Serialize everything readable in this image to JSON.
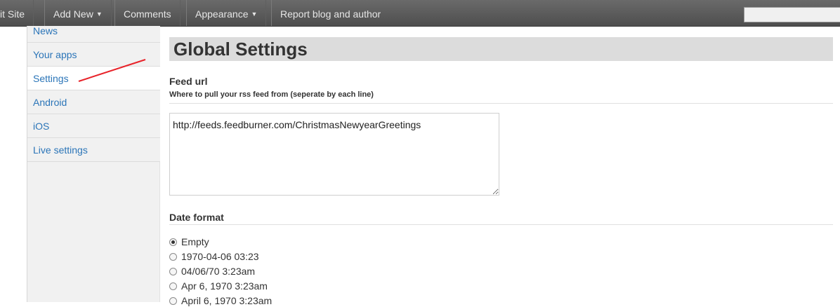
{
  "topbar": {
    "items": [
      {
        "label": "it Site"
      },
      {
        "label": "Add New",
        "caret": "▼"
      },
      {
        "label": "Comments"
      },
      {
        "label": "Appearance",
        "caret": "▼"
      },
      {
        "label": "Report blog and author"
      }
    ],
    "search": {
      "value": ""
    }
  },
  "sidebar": {
    "items": [
      {
        "label": "News"
      },
      {
        "label": "Your apps"
      },
      {
        "label": "Settings"
      },
      {
        "label": "Android"
      },
      {
        "label": "iOS"
      },
      {
        "label": "Live settings"
      }
    ],
    "active": "Settings"
  },
  "main": {
    "title": "Global Settings",
    "feed": {
      "heading": "Feed url",
      "subheading": "Where to pull your rss feed from (seperate by each line)",
      "value": "http://feeds.feedburner.com/ChristmasNewyearGreetings"
    },
    "date_format": {
      "heading": "Date format",
      "options": [
        {
          "label": "Empty",
          "checked": true
        },
        {
          "label": "1970-04-06 03:23",
          "checked": false
        },
        {
          "label": "04/06/70 3:23am",
          "checked": false
        },
        {
          "label": "Apr 6, 1970 3:23am",
          "checked": false
        },
        {
          "label": "April 6, 1970 3:23am",
          "checked": false
        }
      ]
    }
  },
  "colors": {
    "topbar": "#555555",
    "link": "#2b75b8",
    "annotation_arrow": "#e8232a"
  }
}
